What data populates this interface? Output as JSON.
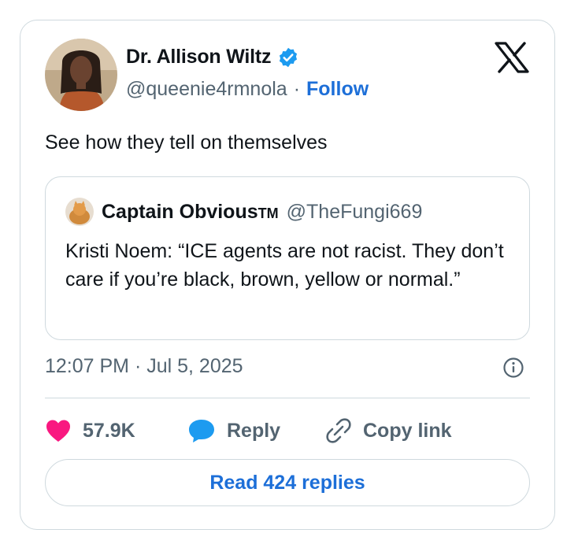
{
  "author": {
    "name": "Dr. Allison Wiltz",
    "handle": "@queenie4rmnola",
    "separator": "·",
    "follow_label": "Follow",
    "verified_icon": "verified-badge-icon"
  },
  "tweet": {
    "text": "See how they tell on themselves"
  },
  "quoted_tweet": {
    "name": "Captain Obvious",
    "name_suffix": "TM",
    "handle": "@TheFungi669",
    "text": "Kristi Noem: “ICE agents are not racist. They don’t care if you’re black, brown, yellow or normal.”"
  },
  "meta": {
    "timestamp": "12:07 PM · Jul 5, 2025"
  },
  "actions": {
    "like_count": "57.9K",
    "reply_label": "Reply",
    "copy_link_label": "Copy link"
  },
  "read_replies_label": "Read 424 replies",
  "colors": {
    "accent": "#1d6fd8",
    "like": "#f91880",
    "reply": "#1d9bf0",
    "muted": "#536471",
    "border": "#cfd9de"
  }
}
